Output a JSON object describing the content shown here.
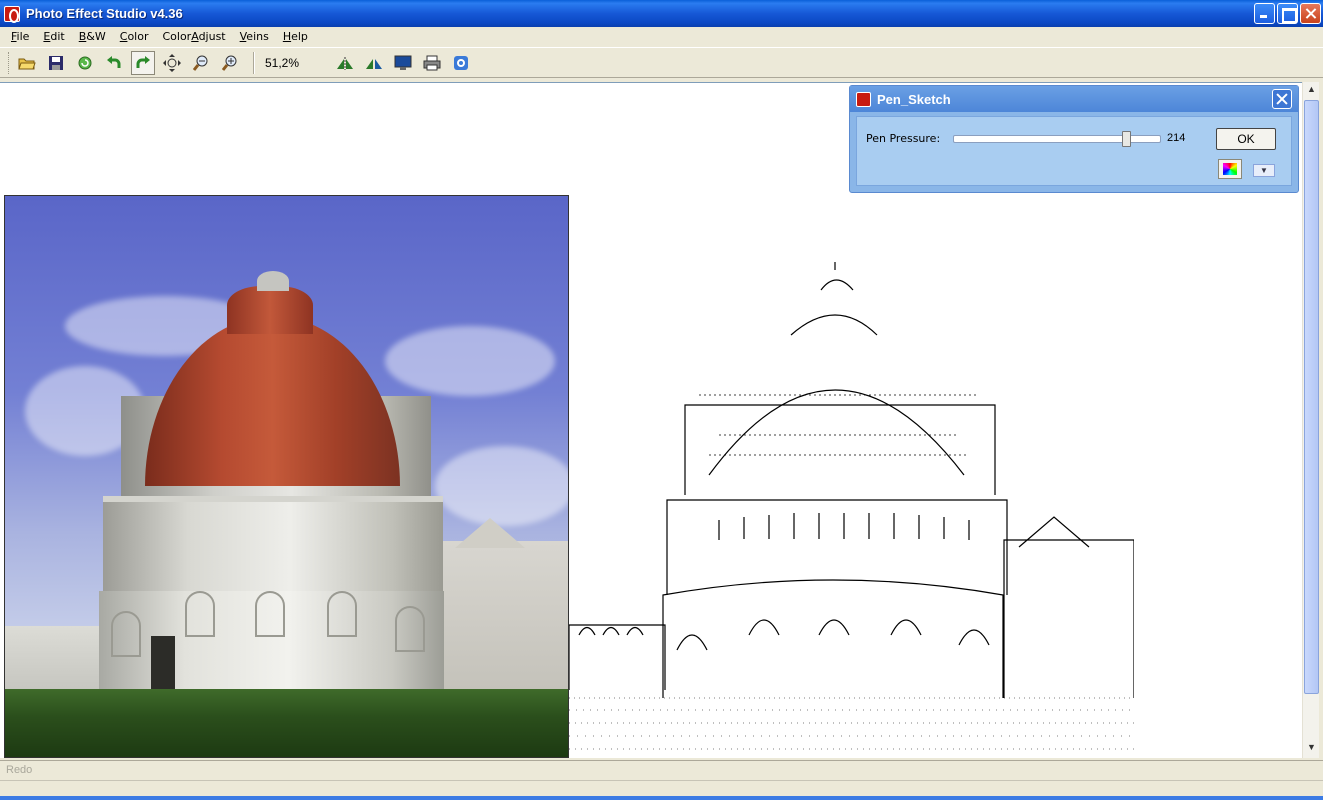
{
  "window": {
    "title": "Photo Effect Studio v4.36"
  },
  "menu": [
    {
      "label": "File",
      "accel": "F"
    },
    {
      "label": "Edit",
      "accel": "E"
    },
    {
      "label": "B&W",
      "accel": "B"
    },
    {
      "label": "Color",
      "accel": "C"
    },
    {
      "label": "ColorAdjust",
      "accel": "A"
    },
    {
      "label": "Veins",
      "accel": "V"
    },
    {
      "label": "Help",
      "accel": "H"
    }
  ],
  "toolbar": {
    "zoom": "51,2%",
    "icons": [
      "open-folder-icon",
      "save-disk-icon",
      "refresh-icon",
      "undo-icon",
      "redo-icon",
      "move-icon",
      "zoom-out-icon",
      "zoom-in-icon",
      "mirror-icon",
      "flip-icon",
      "monitor-icon",
      "printer-icon",
      "settings-cycle-icon"
    ]
  },
  "dialog": {
    "title": "Pen_Sketch",
    "pen_pressure_label": "Pen Pressure:",
    "pen_pressure_value": "214",
    "pen_pressure_fraction": 0.84,
    "ok_label": "OK"
  },
  "status": {
    "text": "Redo"
  },
  "colors": {
    "titlebar": "#1658d6",
    "dialog": "#8ab6e8",
    "roof": "#b54a30",
    "sky": "#6a76d0"
  }
}
